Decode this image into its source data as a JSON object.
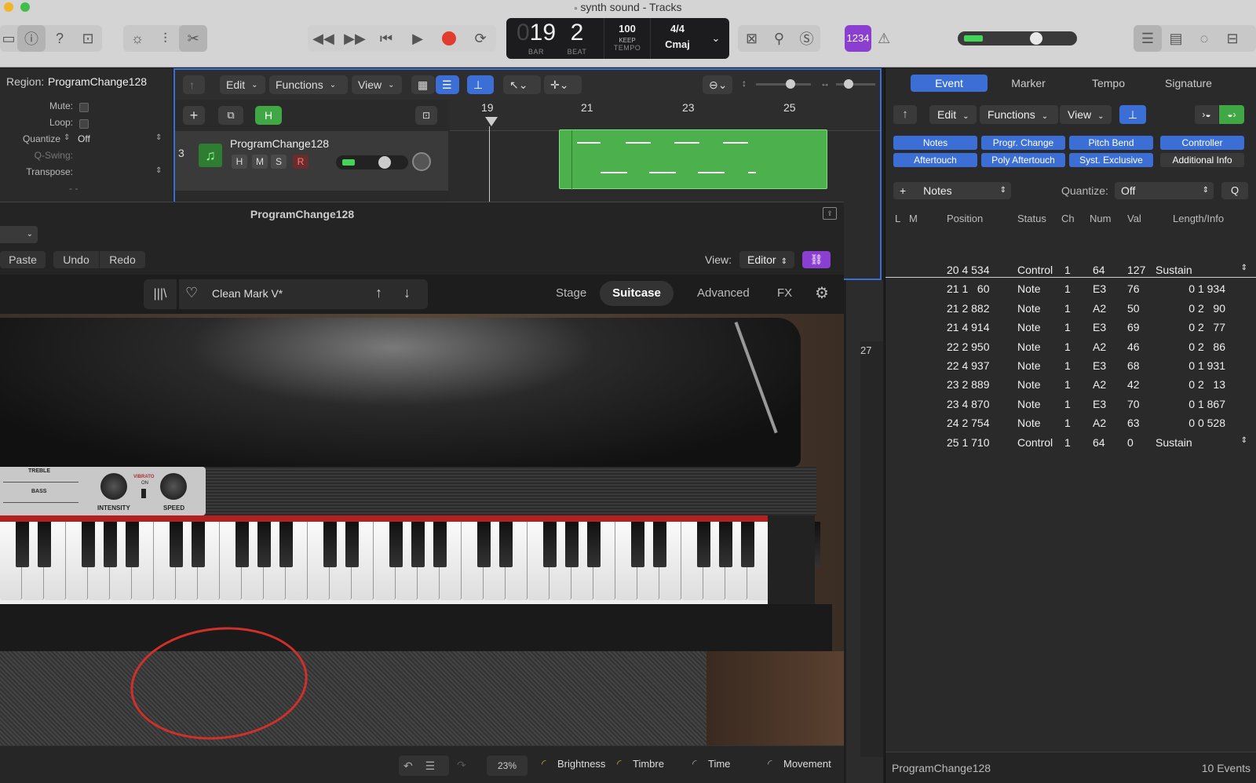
{
  "window": {
    "title": "synth sound - Tracks"
  },
  "colors": {
    "accent": "#3b6fd6",
    "region_green": "#4cb04c",
    "record_red": "#e23b2f",
    "annotation_red": "#d0302a"
  },
  "lcd": {
    "bar": "19",
    "beat": "2",
    "bar_label": "BAR",
    "beat_label": "BEAT",
    "tempo": "100",
    "tempo_mode": "KEEP",
    "tempo_label": "TEMPO",
    "signature": "4/4",
    "key": "Cmaj"
  },
  "toolbar": {
    "count_in": "1234"
  },
  "inspector": {
    "region_label": "Region:",
    "region_name": "ProgramChange128",
    "mute_label": "Mute:",
    "loop_label": "Loop:",
    "quantize_label": "Quantize",
    "quantize_value": "Off",
    "qswing_label": "Q-Swing:",
    "transpose_label": "Transpose:",
    "more": "- -"
  },
  "tracks": {
    "menu": {
      "edit": "Edit",
      "functions": "Functions",
      "view": "View"
    },
    "h_button": "H",
    "track_number": "3",
    "track_name": "ProgramChange128",
    "track_buttons": {
      "h": "H",
      "m": "M",
      "s": "S",
      "r": "R"
    },
    "ruler": [
      "19",
      "21",
      "23",
      "25"
    ],
    "ruler_27": "27"
  },
  "plugin": {
    "title": "ProgramChange128",
    "paste": "Paste",
    "undo": "Undo",
    "redo": "Redo",
    "view_label": "View:",
    "view_value": "Editor",
    "preset_name": "Clean Mark V*",
    "tabs": {
      "stage": "Stage",
      "suitcase": "Suitcase",
      "advanced": "Advanced",
      "fx": "FX"
    },
    "knobs": {
      "treble": "TREBLE",
      "bass": "BASS",
      "vibrato": "VIBRATO",
      "on": "ON",
      "intensity": "INTENSITY",
      "speed": "SPEED"
    },
    "bottom": {
      "zoom": "23%",
      "brightness": "Brightness",
      "timbre": "Timbre",
      "time": "Time",
      "movement": "Movement"
    }
  },
  "event_list": {
    "tabs": {
      "event": "Event",
      "marker": "Marker",
      "tempo": "Tempo",
      "signature": "Signature"
    },
    "menu": {
      "edit": "Edit",
      "functions": "Functions",
      "view": "View"
    },
    "filters": [
      "Notes",
      "Progr. Change",
      "Pitch Bend",
      "Controller",
      "Aftertouch",
      "Poly Aftertouch",
      "Syst. Exclusive",
      "Additional Info"
    ],
    "create_type": "Notes",
    "quantize_label": "Quantize:",
    "quantize_value": "Off",
    "q_button": "Q",
    "columns": {
      "l": "L",
      "m": "M",
      "position": "Position",
      "status": "Status",
      "ch": "Ch",
      "num": "Num",
      "val": "Val",
      "length": "Length/Info"
    },
    "rows": [
      {
        "position": "20 4 534",
        "status": "Control",
        "ch": "1",
        "num": "64",
        "val": "127",
        "info": "Sustain"
      },
      {
        "position": "21 1   60",
        "status": "Note",
        "ch": "1",
        "num": "E3",
        "val": "76",
        "info": "0 1 934"
      },
      {
        "position": "21 2 882",
        "status": "Note",
        "ch": "1",
        "num": "A2",
        "val": "50",
        "info": "0 2   90"
      },
      {
        "position": "21 4 914",
        "status": "Note",
        "ch": "1",
        "num": "E3",
        "val": "69",
        "info": "0 2   77"
      },
      {
        "position": "22 2 950",
        "status": "Note",
        "ch": "1",
        "num": "A2",
        "val": "46",
        "info": "0 2   86"
      },
      {
        "position": "22 4 937",
        "status": "Note",
        "ch": "1",
        "num": "E3",
        "val": "68",
        "info": "0 1 931"
      },
      {
        "position": "23 2 889",
        "status": "Note",
        "ch": "1",
        "num": "A2",
        "val": "42",
        "info": "0 2   13"
      },
      {
        "position": "23 4 870",
        "status": "Note",
        "ch": "1",
        "num": "E3",
        "val": "70",
        "info": "0 1 867"
      },
      {
        "position": "24 2 754",
        "status": "Note",
        "ch": "1",
        "num": "A2",
        "val": "63",
        "info": "0 0 528"
      },
      {
        "position": "25 1 710",
        "status": "Control",
        "ch": "1",
        "num": "64",
        "val": "0",
        "info": "Sustain"
      }
    ],
    "footer_region": "ProgramChange128",
    "footer_count": "10 Events"
  }
}
